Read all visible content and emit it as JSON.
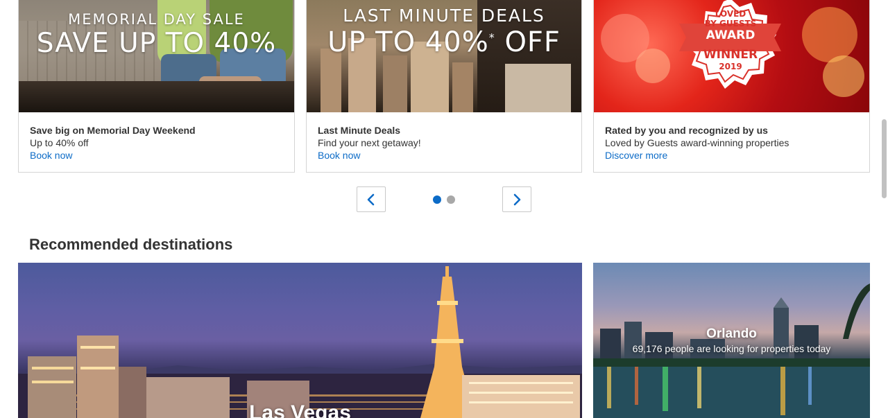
{
  "deals": [
    {
      "overlay_line1": "MEMORIAL DAY SALE",
      "overlay_line2": "SAVE UP TO 40%",
      "title": "Save big on Memorial Day Weekend",
      "subtitle": "Up to 40% off",
      "link": "Book now"
    },
    {
      "overlay_line1": "LAST MINUTE DEALS",
      "overlay_line2": "UP TO 40%",
      "overlay_asterisk": "*",
      "overlay_line2b": "OFF",
      "title": "Last Minute Deals",
      "subtitle": "Find your next getaway!",
      "link": "Book now"
    },
    {
      "badge_line1": "LOVED",
      "badge_line2": "BY GUESTS",
      "badge_line3": "AWARD",
      "badge_line4": "WINNER",
      "badge_line5": "2019",
      "title": "Rated by you and recognized by us",
      "subtitle": "Loved by Guests award-winning properties",
      "link": "Discover more"
    }
  ],
  "carousel": {
    "prev_icon": "chevron-left-icon",
    "next_icon": "chevron-right-icon",
    "active_index": 0,
    "page_count": 2
  },
  "recommended": {
    "heading": "Recommended destinations",
    "destinations": [
      {
        "name": "Las Vegas"
      },
      {
        "name": "Orlando",
        "note": "69,176 people are looking for properties today"
      }
    ]
  },
  "colors": {
    "link": "#0c6bc7",
    "dot_active": "#0c6bc7",
    "dot_inactive": "#a8a8a8",
    "text": "#333333"
  }
}
